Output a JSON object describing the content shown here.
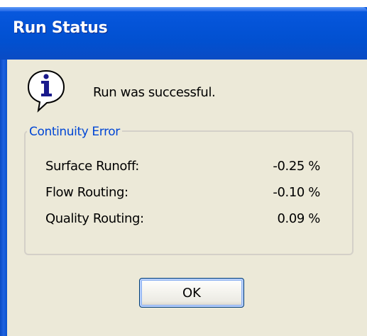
{
  "window": {
    "title": "Run Status"
  },
  "message": {
    "icon": "info-icon",
    "text": "Run was successful."
  },
  "continuity_error": {
    "group_label": "Continuity Error",
    "rows": [
      {
        "label": "Surface Runoff:",
        "value": "-0.25 %"
      },
      {
        "label": "Flow Routing:",
        "value": "-0.10 %"
      },
      {
        "label": "Quality Routing:",
        "value": "0.09 %"
      }
    ]
  },
  "buttons": {
    "ok_label": "OK"
  },
  "colors": {
    "titlebar": "#0454d8",
    "client_background": "#ece9d8",
    "group_label": "#0046d5"
  }
}
